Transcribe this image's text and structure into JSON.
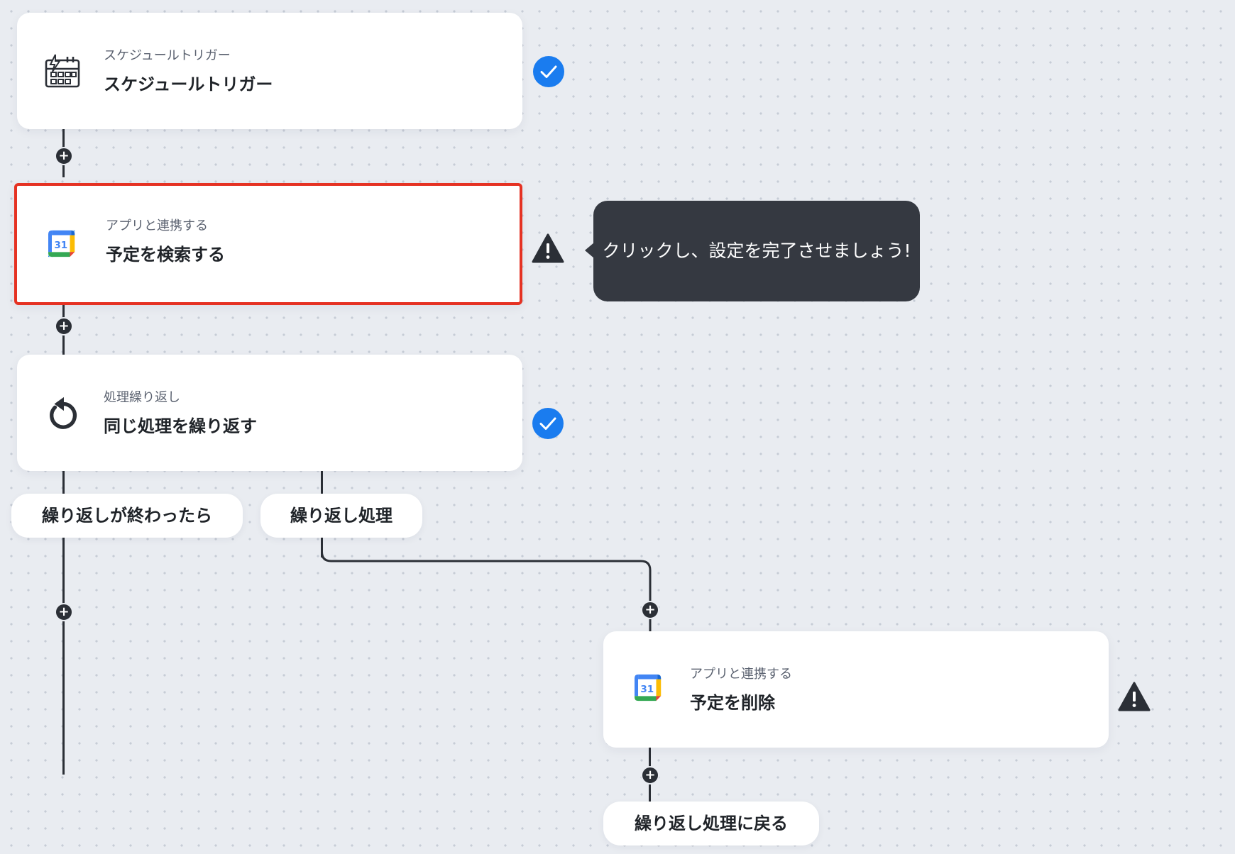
{
  "steps": [
    {
      "category": "スケジュールトリガー",
      "title": "スケジュールトリガー",
      "icon": "schedule-trigger-icon",
      "status": "complete"
    },
    {
      "category": "アプリと連携する",
      "title": "予定を検索する",
      "icon": "google-calendar-icon",
      "status": "warning",
      "selected": true
    },
    {
      "category": "処理繰り返し",
      "title": "同じ処理を繰り返す",
      "icon": "loop-icon",
      "status": "complete"
    },
    {
      "category": "アプリと連携する",
      "title": "予定を削除",
      "icon": "google-calendar-icon",
      "status": "warning"
    }
  ],
  "calendar_icon_text": "31",
  "branches": {
    "after_loop": "繰り返しが終わったら",
    "loop_body": "繰り返し処理",
    "return_to_loop": "繰り返し処理に戻る"
  },
  "tooltip": {
    "text": "クリックし、設定を完了させましょう!"
  },
  "add_button_symbol": "+",
  "colors": {
    "background": "#e9ecf1",
    "connector": "#2b2f36",
    "check": "#1a7cef",
    "selected_border": "#e53223",
    "tooltip": "#353941"
  }
}
